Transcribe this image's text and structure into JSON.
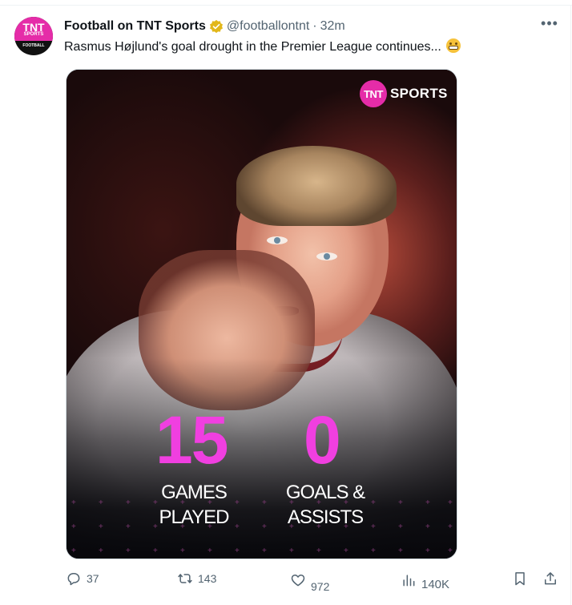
{
  "account": {
    "avatar": {
      "line1": "TNT",
      "line2": "SPORTS",
      "line3": "FOOTBALL"
    },
    "display_name": "Football on TNT Sports",
    "verified": true,
    "handle": "@footballontnt",
    "separator": "·",
    "time": "32m"
  },
  "tweet": {
    "text": "Rasmus Højlund's goal drought in the Premier League continues...",
    "emoji": "grimacing-face"
  },
  "media": {
    "logo_mark": "TNT",
    "logo_word": "SPORTS",
    "stats": [
      {
        "value": "15",
        "label_line1": "GAMES",
        "label_line2": "PLAYED"
      },
      {
        "value": "0",
        "label_line1": "GOALS &",
        "label_line2": "ASSISTS"
      }
    ],
    "accent_color": "#f03fe0"
  },
  "actions": {
    "replies": "37",
    "reposts": "143",
    "likes": "972",
    "likes_above": "972",
    "views": "140K"
  },
  "colors": {
    "brand": "#e52ca8",
    "muted": "#536471",
    "verified": "#e2b719"
  }
}
